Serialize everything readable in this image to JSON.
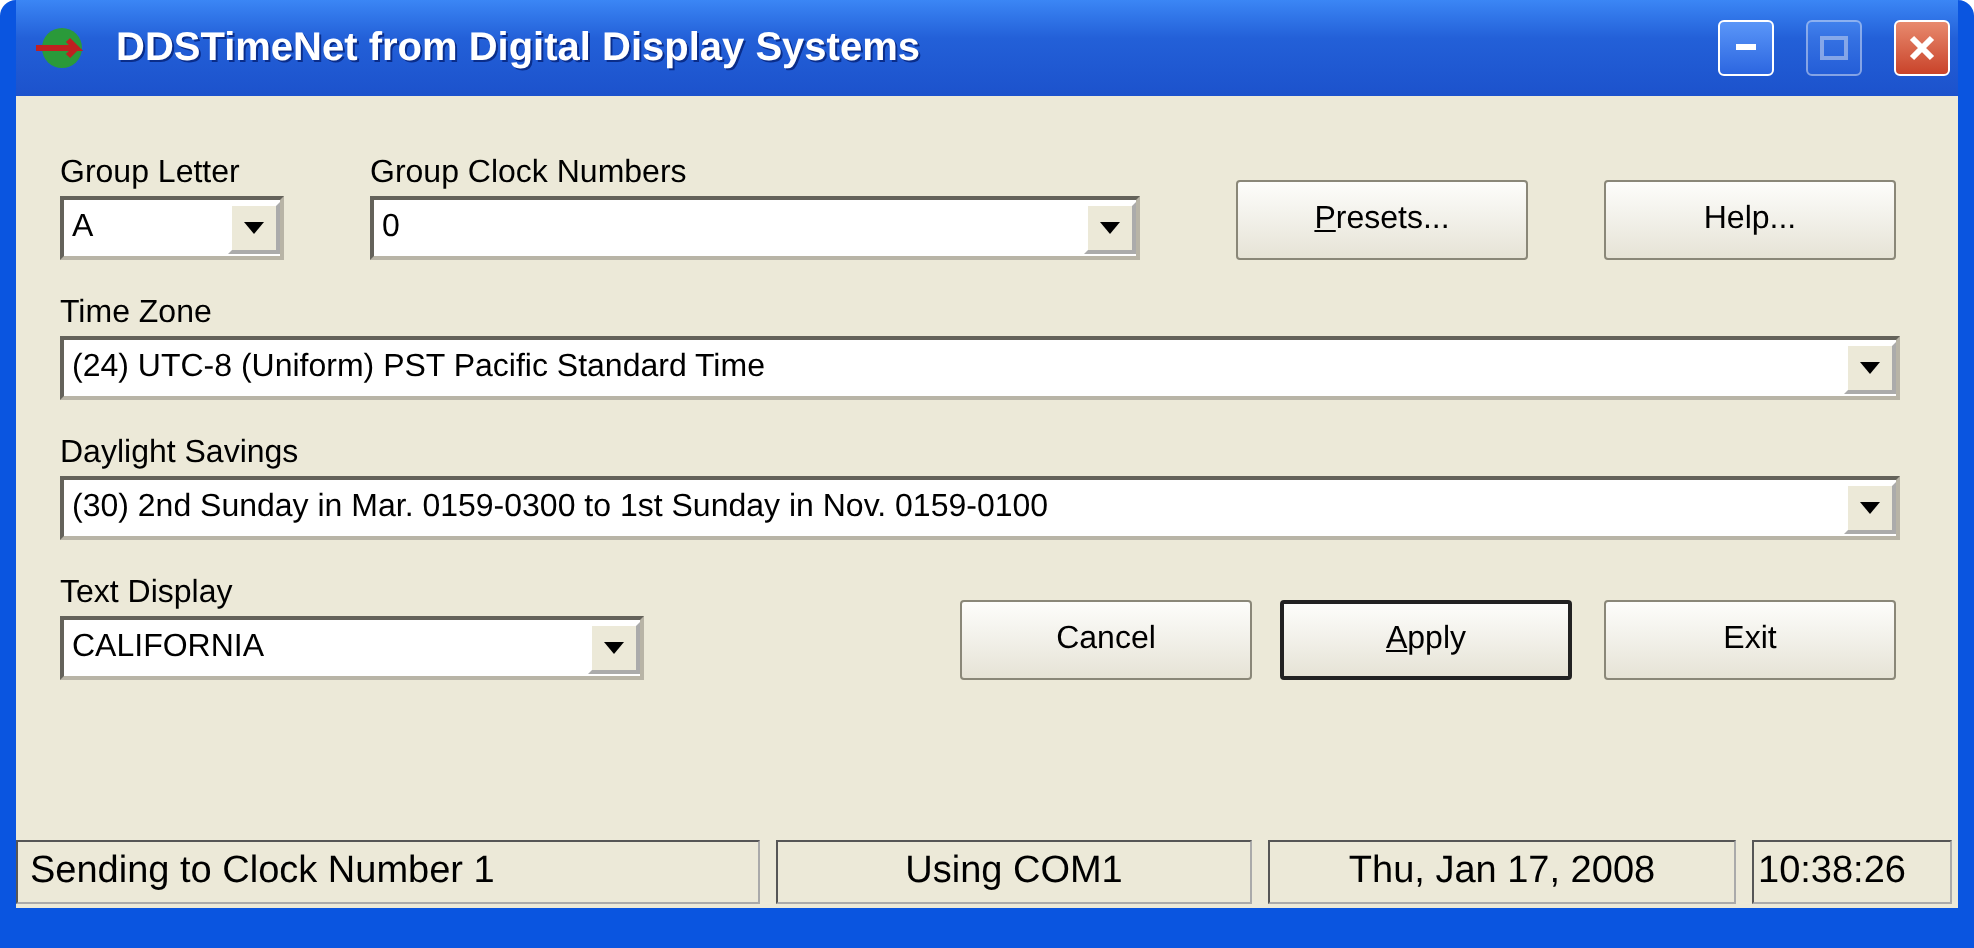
{
  "window": {
    "title": "DDSTimeNet from Digital Display Systems",
    "maximize_disabled": true
  },
  "group_letter": {
    "label": "Group Letter",
    "value": "A"
  },
  "group_clock_numbers": {
    "label": "Group Clock Numbers",
    "value": "0"
  },
  "top_buttons": [
    {
      "label": "Presets...",
      "mnemonic": true,
      "default": false
    },
    {
      "label": "Help...",
      "default": false
    }
  ],
  "time_zone": {
    "label": "Time Zone",
    "value": "(24) UTC-8 (Uniform) PST Pacific Standard Time"
  },
  "daylight_savings": {
    "label": "Daylight Savings",
    "value": "(30) 2nd Sunday in Mar. 0159-0300 to 1st Sunday in Nov. 0159-0100"
  },
  "text_display": {
    "label": "Text Display",
    "value": "CALIFORNIA"
  },
  "bottom_buttons": [
    {
      "label": "Cancel",
      "default": false
    },
    {
      "label": "Apply",
      "mnemonic": true,
      "default": true
    },
    {
      "label": "Exit",
      "default": false
    }
  ],
  "status_bar": [
    "Sending to Clock Number 1",
    "Using COM1",
    "Thu, Jan 17, 2008",
    "10:38:26"
  ]
}
